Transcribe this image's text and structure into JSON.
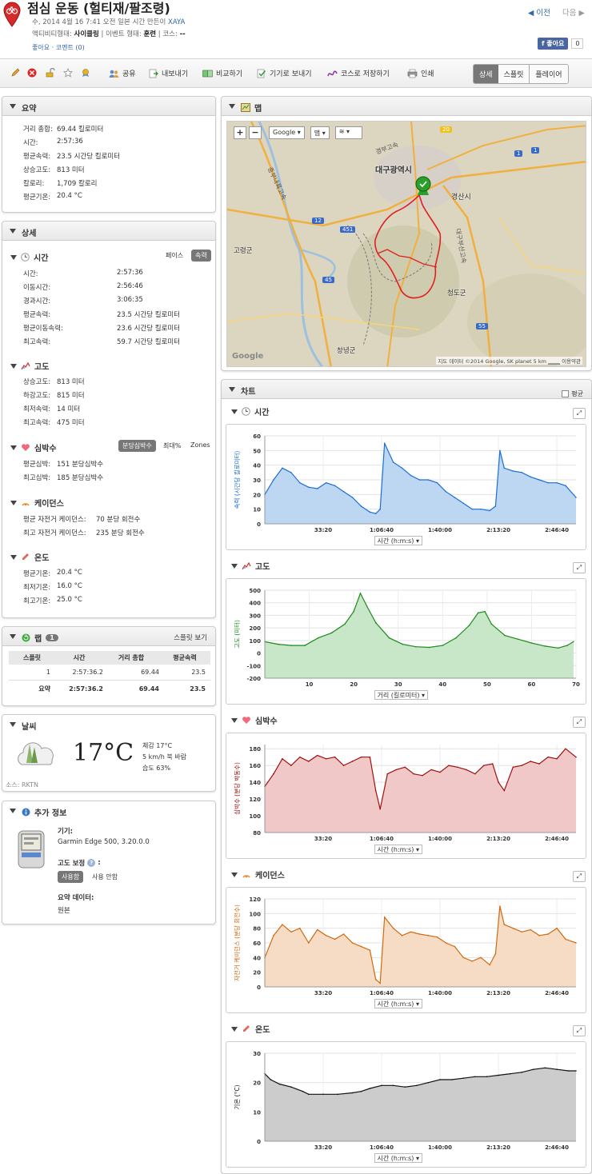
{
  "header": {
    "title": "점심 운동 (헐티재/팔조령)",
    "date_text": "수, 2014 4월 16 7:41 오전 일본 시간 만든이",
    "author": "XAYA",
    "activity_label": "액티비티형태:",
    "activity_value": "사이클링",
    "event_label": "이벤트 형태:",
    "event_value": "훈련",
    "course_label": "코스:",
    "course_value": "--",
    "like_link": "좋아요",
    "comments_link": "코멘트 (0)",
    "prev": "◀ 이전",
    "next": "다음 ▶",
    "fb_like": "좋아요",
    "fb_count": "0"
  },
  "toolbar": {
    "share": "공유",
    "export": "내보내기",
    "compare": "비교하기",
    "send": "기기로 보내기",
    "save_course": "코스로 저장하기",
    "print": "인쇄",
    "tabs": [
      "상세",
      "스플릿",
      "플레이어"
    ]
  },
  "summary": {
    "title": "요약",
    "rows": [
      [
        "거리 총합:",
        "69.44 킬로미터"
      ],
      [
        "시간:",
        "2:57:36"
      ],
      [
        "평균속력:",
        "23.5 시간당 킬로미터"
      ],
      [
        "상승고도:",
        "813 미터"
      ],
      [
        "칼로리:",
        "1,709 칼로리"
      ],
      [
        "평균기온:",
        "20.4 °C"
      ]
    ]
  },
  "details": {
    "title": "상세",
    "time": {
      "title": "시간",
      "toggle": [
        "페이스",
        "속력"
      ],
      "rows": [
        [
          "시간:",
          "2:57:36"
        ],
        [
          "이동시간:",
          "2:56:46"
        ],
        [
          "경과시간:",
          "3:06:35"
        ],
        [
          "평균속력:",
          "23.5 시간당 킬로미터"
        ],
        [
          "평균이동속력:",
          "23.6 시간당 킬로미터"
        ],
        [
          "최고속력:",
          "59.7 시간당 킬로미터"
        ]
      ]
    },
    "elev": {
      "title": "고도",
      "rows": [
        [
          "상승고도:",
          "813 미터"
        ],
        [
          "하강고도:",
          "815 미터"
        ],
        [
          "최저속력:",
          "14 미터"
        ],
        [
          "최고속력:",
          "475 미터"
        ]
      ]
    },
    "hr": {
      "title": "심박수",
      "toggle": [
        "분당심박수",
        "최대%",
        "Zones"
      ],
      "rows": [
        [
          "평균심박:",
          "151 분당심박수"
        ],
        [
          "최고심박:",
          "185 분당심박수"
        ]
      ]
    },
    "cad": {
      "title": "케이던스",
      "rows": [
        [
          "평균 자전거 케이던스:",
          "70 분당 회전수"
        ],
        [
          "최고 자전거 케이던스:",
          "235 분당 회전수"
        ]
      ]
    },
    "temp": {
      "title": "온도",
      "rows": [
        [
          "평균기온:",
          "20.4 °C"
        ],
        [
          "최저기온:",
          "16.0 °C"
        ],
        [
          "최고기온:",
          "25.0 °C"
        ]
      ]
    }
  },
  "laps": {
    "title": "랩",
    "count": "1",
    "splits_link": "스플릿 보기",
    "headers": [
      "스플릿",
      "시간",
      "거리 총합",
      "평균속력"
    ],
    "rows": [
      [
        "1",
        "2:57:36.2",
        "69.44",
        "23.5"
      ]
    ],
    "summary": [
      "요약",
      "2:57:36.2",
      "69.44",
      "23.5"
    ]
  },
  "weather": {
    "title": "날씨",
    "temp": "17°C",
    "feels": "체감 17°C",
    "wind": "5 km/h 북 바람",
    "humidity": "습도 63%",
    "source": "소스: RKTN"
  },
  "extra": {
    "title": "추가 정보",
    "device_label": "기기:",
    "device": "Garmin Edge 500, 3.20.0.0",
    "elev_corr_label": "고도 보정",
    "elev_opts": [
      "사용함",
      "사용 안함"
    ],
    "summary_data_label": "요약 데이터:",
    "summary_data": "원본"
  },
  "map": {
    "title": "맵",
    "zoom_in": "+",
    "zoom_out": "−",
    "provider": "Google",
    "maptype": "맵",
    "labels": [
      "대구광역시",
      "경산시",
      "고령군",
      "청도군",
      "창녕군",
      "경부고속",
      "중부내륙고속",
      "대구부산고속"
    ],
    "attribution": "지도 데이터 ©2014 Google, SK planet",
    "scale": "5 km",
    "terms": "이용약관",
    "google": "Google",
    "roads": [
      "20",
      "1",
      "12",
      "451",
      "45",
      "55",
      "1"
    ]
  },
  "charts_panel": {
    "title": "차트",
    "avg_label": "평균"
  },
  "chart_data": [
    {
      "id": "speed",
      "type": "area",
      "title": "시간",
      "ylabel": "속력 (시간당 킬로미터)",
      "xlabel": "시간 (h:m:s)",
      "yticks": [
        0,
        10,
        20,
        30,
        40,
        50,
        60
      ],
      "ylim": [
        0,
        60
      ],
      "xticks": [
        "33:20",
        "1:06:40",
        "1:40:00",
        "2:13:20",
        "2:46:40"
      ],
      "xtick_pos": [
        2000,
        4000,
        6000,
        8000,
        10000
      ],
      "xlim": [
        0,
        10656
      ],
      "color": "#1a6fd6",
      "fill": "#bdd7f2",
      "x": [
        0,
        300,
        600,
        900,
        1200,
        1500,
        1800,
        2100,
        2400,
        2700,
        3000,
        3300,
        3600,
        3800,
        3950,
        4100,
        4400,
        4700,
        5000,
        5300,
        5600,
        5900,
        6200,
        6500,
        6800,
        7100,
        7400,
        7700,
        7900,
        8050,
        8200,
        8500,
        8800,
        9100,
        9400,
        9700,
        10000,
        10300,
        10656
      ],
      "values": [
        20,
        30,
        38,
        35,
        28,
        25,
        24,
        28,
        26,
        22,
        18,
        12,
        8,
        7,
        10,
        55,
        42,
        38,
        33,
        30,
        30,
        28,
        22,
        18,
        14,
        10,
        10,
        9,
        12,
        50,
        38,
        36,
        35,
        32,
        30,
        28,
        28,
        26,
        18
      ]
    },
    {
      "id": "elev",
      "type": "area",
      "title": "고도",
      "ylabel": "고도 (미터)",
      "xlabel": "거리 (킬로미터)",
      "yticks": [
        -200,
        -100,
        0,
        100,
        200,
        300,
        400,
        500
      ],
      "ylim": [
        -200,
        500
      ],
      "xticks": [
        "10",
        "20",
        "30",
        "40",
        "50",
        "60",
        "70"
      ],
      "xtick_pos": [
        10,
        20,
        30,
        40,
        50,
        60,
        70
      ],
      "xlim": [
        0,
        70
      ],
      "color": "#1d8a1d",
      "fill": "#c8e6c8",
      "x": [
        0,
        3,
        6,
        9,
        12,
        15,
        18,
        20,
        21.5,
        23,
        25,
        28,
        31,
        34,
        37,
        40,
        43,
        46,
        48,
        49.5,
        51,
        54,
        57,
        60,
        63,
        66,
        68,
        69.44
      ],
      "values": [
        90,
        70,
        60,
        60,
        120,
        160,
        230,
        330,
        475,
        370,
        240,
        120,
        70,
        50,
        45,
        60,
        120,
        220,
        320,
        330,
        230,
        140,
        110,
        80,
        55,
        40,
        60,
        90
      ]
    },
    {
      "id": "hr",
      "type": "area",
      "title": "심박수",
      "ylabel": "심박수 (분당 박동수)",
      "xlabel": "시간 (h:m:s)",
      "yticks": [
        80,
        100,
        120,
        140,
        160,
        180
      ],
      "ylim": [
        80,
        185
      ],
      "xticks": [
        "33:20",
        "1:06:40",
        "1:40:00",
        "2:13:20",
        "2:46:40"
      ],
      "xtick_pos": [
        2000,
        4000,
        6000,
        8000,
        10000
      ],
      "xlim": [
        0,
        10656
      ],
      "color": "#a01010",
      "fill": "#f0c8c8",
      "x": [
        0,
        300,
        600,
        900,
        1200,
        1500,
        1800,
        2100,
        2400,
        2700,
        3000,
        3300,
        3600,
        3800,
        3950,
        4200,
        4500,
        4800,
        5100,
        5400,
        5700,
        6000,
        6300,
        6600,
        6900,
        7200,
        7500,
        7800,
        8000,
        8200,
        8500,
        8800,
        9100,
        9400,
        9700,
        10000,
        10300,
        10656
      ],
      "values": [
        135,
        150,
        168,
        160,
        170,
        165,
        172,
        168,
        170,
        160,
        165,
        170,
        170,
        130,
        108,
        150,
        155,
        158,
        150,
        148,
        155,
        152,
        160,
        158,
        155,
        150,
        160,
        162,
        140,
        130,
        158,
        160,
        165,
        162,
        170,
        168,
        180,
        170
      ]
    },
    {
      "id": "cad",
      "type": "area",
      "title": "케이던스",
      "ylabel": "자전거 케이던스 (분당 회전수)",
      "xlabel": "시간 (h:m:s)",
      "yticks": [
        0,
        20,
        40,
        60,
        80,
        100,
        120
      ],
      "ylim": [
        0,
        120
      ],
      "xticks": [
        "33:20",
        "1:06:40",
        "1:40:00",
        "2:13:20",
        "2:46:40"
      ],
      "xtick_pos": [
        2000,
        4000,
        6000,
        8000,
        10000
      ],
      "xlim": [
        0,
        10656
      ],
      "color": "#d06a10",
      "fill": "#f6dcc4",
      "x": [
        0,
        300,
        600,
        900,
        1200,
        1500,
        1800,
        2100,
        2400,
        2700,
        3000,
        3300,
        3600,
        3800,
        3950,
        4100,
        4400,
        4700,
        5000,
        5300,
        5600,
        5900,
        6200,
        6500,
        6800,
        7100,
        7400,
        7700,
        7900,
        8050,
        8200,
        8500,
        8800,
        9100,
        9400,
        9700,
        10000,
        10300,
        10656
      ],
      "values": [
        40,
        70,
        85,
        75,
        80,
        60,
        78,
        70,
        65,
        72,
        60,
        55,
        50,
        10,
        5,
        95,
        80,
        70,
        75,
        72,
        70,
        68,
        60,
        55,
        40,
        35,
        40,
        30,
        45,
        110,
        85,
        80,
        75,
        78,
        70,
        72,
        80,
        65,
        60
      ]
    },
    {
      "id": "temp",
      "type": "area",
      "title": "온도",
      "ylabel": "기온 (°C)",
      "xlabel": "시간 (h:m:s)",
      "yticks": [
        0,
        10,
        20,
        30
      ],
      "ylim": [
        0,
        30
      ],
      "xticks": [
        "33:20",
        "1:06:40",
        "1:40:00",
        "2:13:20",
        "2:46:40"
      ],
      "xtick_pos": [
        2000,
        4000,
        6000,
        8000,
        10000
      ],
      "xlim": [
        0,
        10656
      ],
      "color": "#111111",
      "fill": "#cccccc",
      "x": [
        0,
        200,
        500,
        900,
        1300,
        1500,
        2000,
        2500,
        3000,
        3300,
        3600,
        4000,
        4400,
        4800,
        5200,
        5600,
        6000,
        6400,
        6800,
        7200,
        7600,
        8000,
        8400,
        8800,
        9200,
        9600,
        10000,
        10400,
        10656
      ],
      "values": [
        23,
        21,
        19.5,
        18.5,
        17,
        16,
        16,
        16,
        16.5,
        17,
        18,
        19,
        19,
        18.5,
        19,
        20,
        21,
        21,
        21.5,
        22,
        22,
        22.5,
        23,
        23.5,
        24.5,
        25,
        24.5,
        24,
        24
      ]
    }
  ]
}
